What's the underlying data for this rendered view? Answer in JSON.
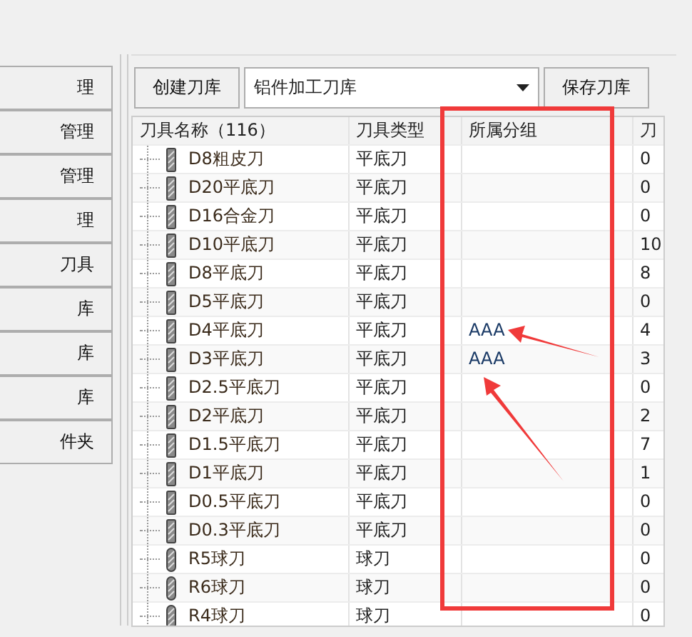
{
  "side_buttons": [
    "理",
    "管理",
    "管理",
    "理",
    "刀具",
    "库",
    "库",
    "库",
    "件夹"
  ],
  "toolbar": {
    "create_button": "创建刀库",
    "library_select": {
      "value": "铝件加工刀库"
    },
    "save_button": "保存刀库"
  },
  "table": {
    "columns": [
      "刀具名称（116）",
      "刀具类型",
      "所属分组",
      "刀"
    ],
    "rows": [
      {
        "kind": "flat",
        "cells": [
          "D8粗皮刀",
          "平底刀",
          "",
          "0"
        ]
      },
      {
        "kind": "flat",
        "cells": [
          "D20平底刀",
          "平底刀",
          "",
          "0"
        ]
      },
      {
        "kind": "flat",
        "cells": [
          "D16合金刀",
          "平底刀",
          "",
          "0"
        ]
      },
      {
        "kind": "flat",
        "cells": [
          "D10平底刀",
          "平底刀",
          "",
          "10"
        ]
      },
      {
        "kind": "flat",
        "cells": [
          "D8平底刀",
          "平底刀",
          "",
          "8"
        ]
      },
      {
        "kind": "flat",
        "cells": [
          "D5平底刀",
          "平底刀",
          "",
          "0"
        ]
      },
      {
        "kind": "flat",
        "cells": [
          "D4平底刀",
          "平底刀",
          "AAA",
          "4"
        ]
      },
      {
        "kind": "flat",
        "cells": [
          "D3平底刀",
          "平底刀",
          "AAA",
          "3"
        ]
      },
      {
        "kind": "flat",
        "cells": [
          "D2.5平底刀",
          "平底刀",
          "",
          "0"
        ]
      },
      {
        "kind": "flat",
        "cells": [
          "D2平底刀",
          "平底刀",
          "",
          "2"
        ]
      },
      {
        "kind": "flat",
        "cells": [
          "D1.5平底刀",
          "平底刀",
          "",
          "7"
        ]
      },
      {
        "kind": "flat",
        "cells": [
          "D1平底刀",
          "平底刀",
          "",
          "1"
        ]
      },
      {
        "kind": "flat",
        "cells": [
          "D0.5平底刀",
          "平底刀",
          "",
          "0"
        ]
      },
      {
        "kind": "flat",
        "cells": [
          "D0.3平底刀",
          "平底刀",
          "",
          "0"
        ]
      },
      {
        "kind": "ball",
        "cells": [
          "R5球刀",
          "球刀",
          "",
          "0"
        ]
      },
      {
        "kind": "ball",
        "cells": [
          "R6球刀",
          "球刀",
          "",
          "0"
        ]
      },
      {
        "kind": "ball",
        "cells": [
          "R4球刀",
          "球刀",
          "",
          "0"
        ]
      }
    ]
  }
}
